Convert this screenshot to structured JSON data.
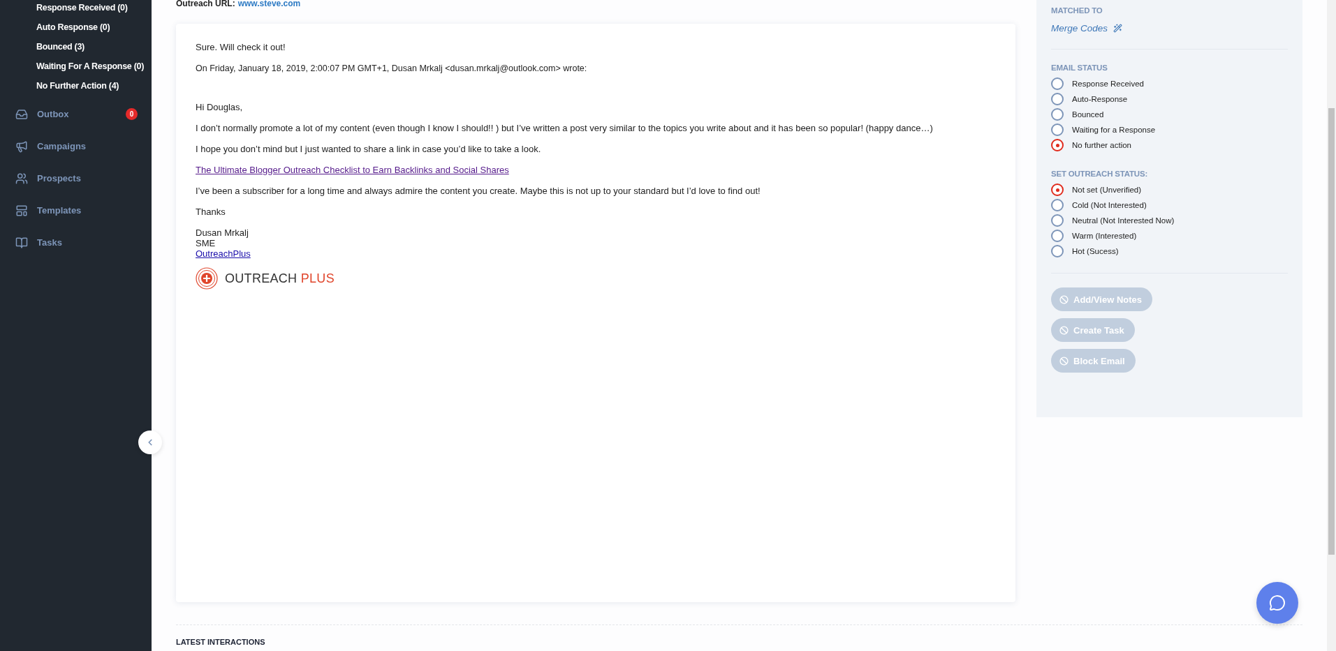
{
  "sidebar": {
    "sub_items": [
      {
        "label": "Response Received (0)"
      },
      {
        "label": "Auto Response (0)"
      },
      {
        "label": "Bounced (3)"
      },
      {
        "label": "Waiting For A Response (0)"
      },
      {
        "label": "No Further Action (4)"
      }
    ],
    "nav": [
      {
        "label": "Outbox",
        "badge": "0"
      },
      {
        "label": "Campaigns"
      },
      {
        "label": "Prospects"
      },
      {
        "label": "Templates"
      },
      {
        "label": "Tasks"
      }
    ]
  },
  "outreach_url": {
    "label": "Outreach URL:",
    "value": "www.steve.com"
  },
  "email": {
    "reply": "Sure. Will check it out!",
    "quote_header": "On Friday, January 18, 2019, 2:00:07 PM GMT+1, Dusan Mrkalj <dusan.mrkalj@outlook.com> wrote:",
    "paragraphs": [
      {
        "kind": "text",
        "text": "Hi Douglas,"
      },
      {
        "kind": "text",
        "text": "I don’t normally promote a lot of my content (even though I know I should!! ) but I’ve written a post very similar to the topics you write about and it has been so popular! (happy dance…)"
      },
      {
        "kind": "text",
        "text": "I hope you don’t mind but I just wanted to share a link in case you’d like to take a look."
      },
      {
        "kind": "link",
        "text": "The Ultimate Blogger Outreach Checklist to Earn Backlinks and Social Shares"
      },
      {
        "kind": "text",
        "text": "I’ve been a subscriber for a long time and always admire the content you create. Maybe this is not up to your standard but I’d love to find out!"
      },
      {
        "kind": "text",
        "text": "Thanks"
      }
    ],
    "signature": {
      "lines": [
        "Dusan Mrkalj",
        "SME"
      ],
      "link": "OutreachPlus"
    },
    "logo": {
      "name": "OUTREACH",
      "accent": "PLUS"
    }
  },
  "latest_interactions": {
    "heading": "LATEST INTERACTIONS"
  },
  "panel": {
    "matched_to": {
      "heading": "MATCHED TO",
      "value": "Merge Codes"
    },
    "email_status": {
      "heading": "EMAIL STATUS",
      "options": [
        {
          "label": "Response Received",
          "selected": false
        },
        {
          "label": "Auto-Response",
          "selected": false
        },
        {
          "label": "Bounced",
          "selected": false
        },
        {
          "label": "Waiting for a Response",
          "selected": false
        },
        {
          "label": "No further action",
          "selected": true
        }
      ]
    },
    "outreach_status": {
      "heading": "SET OUTREACH STATUS:",
      "options": [
        {
          "label": "Not set (Unverified)",
          "selected": true
        },
        {
          "label": "Cold (Not Interested)",
          "selected": false
        },
        {
          "label": "Neutral (Not Interested Now)",
          "selected": false
        },
        {
          "label": "Warm (Interested)",
          "selected": false
        },
        {
          "label": "Hot (Sucess)",
          "selected": false
        }
      ]
    },
    "actions": [
      {
        "label": "Add/View Notes",
        "disabled": true
      },
      {
        "label": "Create Task",
        "disabled": true
      },
      {
        "label": "Block Email",
        "disabled": true
      }
    ]
  }
}
